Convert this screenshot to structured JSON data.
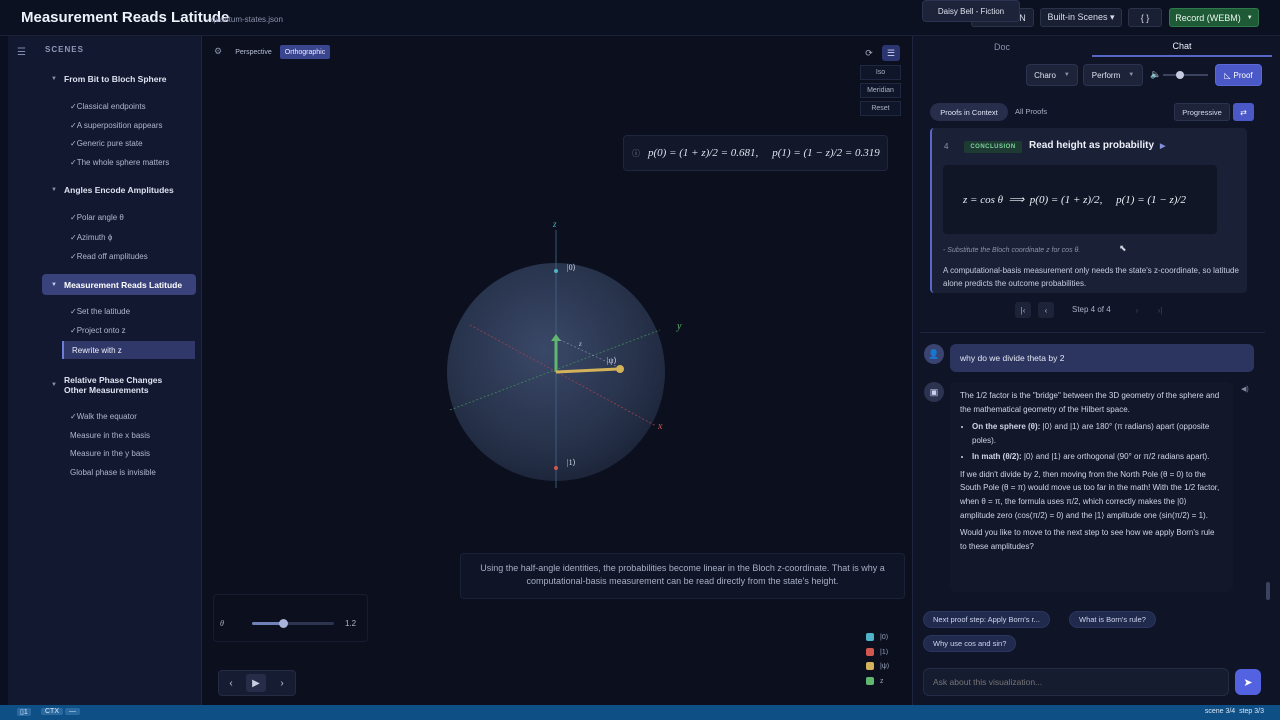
{
  "app": {
    "title": "Measurement Reads Latitude",
    "file": "- quantum-states.json"
  },
  "toolbar": {
    "load_json": "Load JSON",
    "built_in": "Built-in Scenes ▾",
    "braces": "{ }",
    "record": "Record (WEBM)"
  },
  "sidebar": {
    "heading": "SCENES",
    "sections": [
      {
        "title": "From Bit to Bloch Sphere",
        "items": [
          "Classical endpoints",
          "A superposition appears",
          "Generic pure state",
          "The whole sphere matters"
        ]
      },
      {
        "title": "Angles Encode Amplitudes",
        "items": [
          "Polar angle θ",
          "Azimuth ϕ",
          "Read off amplitudes"
        ]
      },
      {
        "title": "Measurement Reads Latitude",
        "items": [
          "Set the latitude",
          "Project onto z",
          "Rewrite with z"
        ]
      },
      {
        "title": "Relative Phase Changes Other Measurements",
        "items": [
          "Walk the equator",
          "Measure in the x basis",
          "Measure in the y basis",
          "Global phase is invisible"
        ]
      }
    ],
    "check": "✓"
  },
  "viewport": {
    "perspective": "Perspective",
    "orthographic": "Orthographic",
    "iso": "Iso",
    "meridian": "Meridian",
    "reset": "Reset",
    "formula": {
      "p0": "p(0) = (1 + z)/2 = 0.681,",
      "p1": "p(1) = (1 − z)/2 = 0.319"
    },
    "axis_z": "z",
    "axis_y": "y",
    "axis_x": "x",
    "ket0": "|0⟩",
    "ket1": "|1⟩",
    "ketpsi": "|ψ⟩",
    "z_tick": "z",
    "caption": "Using the half-angle identities, the probabilities become linear in the Bloch z-coordinate. That is why a computational-basis measurement can be read directly from the state's height.",
    "slider_label": "θ",
    "slider_value": "1.2",
    "slider_fraction": 0.38,
    "legend": [
      {
        "label": "|0⟩",
        "color": "#4fb3c9"
      },
      {
        "label": "|1⟩",
        "color": "#d0584f"
      },
      {
        "label": "|ψ⟩",
        "color": "#d4b25a"
      },
      {
        "label": "z",
        "color": "#5fb86d"
      }
    ]
  },
  "right": {
    "tab_doc": "Doc",
    "tab_chat": "Chat",
    "song": "Daisy Bell - Fiction",
    "voice": "Charo",
    "mode": "Perform",
    "proof_btn": "Proof",
    "proofs_in_context": "Proofs in Context",
    "all_proofs": "All Proofs",
    "progressive": "Progressive",
    "step_num": "4",
    "badge": "CONCLUSION",
    "step_title": "Read height as probability",
    "math_line": "z = cos θ  ⟹  p(0) = (1 + z)/2,     p(1) = (1 − z)/2",
    "substitute": "- Substitute the Bloch coordinate z for cos θ.",
    "explanation": "A computational-basis measurement only needs the state's z-coordinate, so latitude alone predicts the outcome probabilities.",
    "step_of": "Step 4 of 4"
  },
  "chat": {
    "user_msg": "why do we divide theta by 2",
    "p1": "The 1/2 factor is the \"bridge\" between the 3D geometry of the sphere and the mathematical geometry of the Hilbert space.",
    "b1_head": "On the sphere (θ):",
    "b1_text": "|0⟩ and |1⟩ are 180° (π radians) apart (opposite poles).",
    "b2_head": "In math (θ/2):",
    "b2_text": "|0⟩ and |1⟩ are orthogonal (90° or π/2 radians apart).",
    "p2": "If we didn't divide by 2, then moving from the North Pole (θ = 0) to the South Pole (θ = π) would move us too far in the math! With the 1/2 factor, when θ = π, the formula uses π/2, which correctly makes the |0⟩ amplitude zero (cos(π/2) = 0) and the |1⟩ amplitude one (sin(π/2) = 1).",
    "p3": "Would you like to move to the next step to see how we apply Born's rule to these amplitudes?",
    "chips": [
      "Next proof step: Apply Born's r...",
      "What is Born's rule?",
      "Why use cos and sin?"
    ],
    "placeholder": "Ask about this visualization..."
  },
  "status": {
    "left1": "1",
    "ctx": "CTX",
    "right": "scene 3/4  step 3/3"
  }
}
